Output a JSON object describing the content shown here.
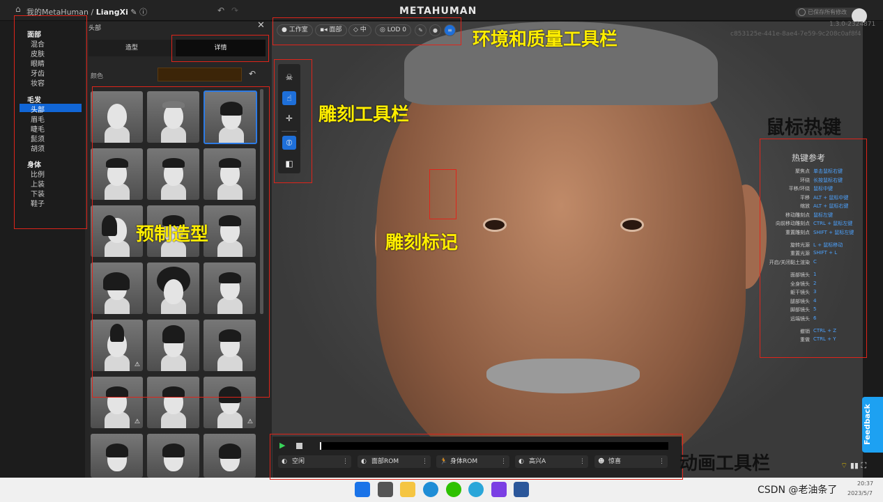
{
  "topbar": {
    "breadcrumb_root": "我的MetaHuman",
    "breadcrumb_sep": "/",
    "breadcrumb_current": "LiangXi",
    "logo": "METAHUMAN",
    "saved": "已保存所有修改",
    "undo": "↶",
    "redo": "↷"
  },
  "nav": {
    "sections": [
      {
        "title": "面部",
        "items": [
          "混合",
          "皮肤",
          "眼睛",
          "牙齿",
          "妆容"
        ]
      },
      {
        "title": "毛发",
        "items": [
          "头部",
          "眉毛",
          "睫毛",
          "髭须",
          "胡须"
        ]
      },
      {
        "title": "身体",
        "items": [
          "比例",
          "上装",
          "下装",
          "鞋子"
        ]
      }
    ],
    "selected": "头部"
  },
  "panel": {
    "title": "头部",
    "close": "✕",
    "tabs": [
      "造型",
      "详情"
    ],
    "color_label": "颜色",
    "reset": "↶"
  },
  "viewport": {
    "version": "1.3.0-2324871",
    "hash": "c853125e-441e-8ae4-7e59-9c208c0af8f4"
  },
  "env_toolbar": {
    "items": [
      "工作室",
      "面部",
      "中",
      "LOD 0"
    ]
  },
  "hotkeys": {
    "title": "热键参考",
    "rows": [
      [
        "聚焦点",
        "单击鼠标右键"
      ],
      [
        "环绕",
        "长按鼠标右键"
      ],
      [
        "平移/环绕",
        "鼠标中键"
      ],
      [
        "平移",
        "ALT + 鼠标中键"
      ],
      [
        "缩放",
        "ALT + 鼠标右键"
      ],
      [
        "移动雕刻点",
        "鼠标左键"
      ],
      [
        "向前移动雕刻点",
        "CTRL + 鼠标左键"
      ],
      [
        "重置雕刻点",
        "SHIFT + 鼠标左键"
      ],
      [
        "旋转光源",
        "L + 鼠标移动"
      ],
      [
        "重置光源",
        "SHIFT + L"
      ],
      [
        "开启/关闭黏土渲染",
        "C"
      ],
      [
        "面部镜头",
        "1"
      ],
      [
        "全身镜头",
        "2"
      ],
      [
        "躯干镜头",
        "3"
      ],
      [
        "腿部镜头",
        "4"
      ],
      [
        "脚部镜头",
        "5"
      ],
      [
        "远端镜头",
        "6"
      ],
      [
        "撤销",
        "CTRL + Z"
      ],
      [
        "重做",
        "CTRL + Y"
      ]
    ]
  },
  "anim_toolbar": {
    "items": [
      "空闲",
      "面部ROM",
      "身体ROM",
      "高兴A",
      "惊喜"
    ]
  },
  "feedback": "Feedback",
  "taskbar": {
    "watermark": "CSDN @老油条了",
    "time": "20:37",
    "date": "2023/5/7"
  },
  "annotations": {
    "env": "环境和质量工具栏",
    "sculpt": "雕刻工具栏",
    "hotkeys": "鼠标热键",
    "presets": "预制造型",
    "marker": "雕刻标记",
    "anim": "动画工具栏"
  }
}
